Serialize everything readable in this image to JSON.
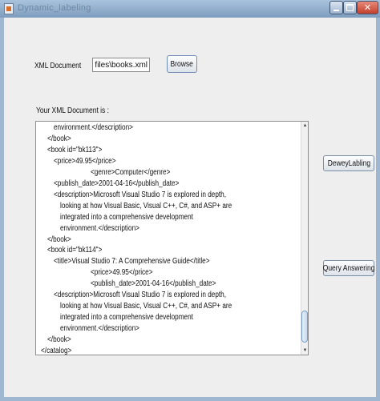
{
  "window": {
    "title": "Dynamic_labeling",
    "minimize_icon": "minimize-icon",
    "maximize_icon": "maximize-icon",
    "close_icon": "close-icon",
    "close_glyph": "✕"
  },
  "form": {
    "xml_label": "XML Document",
    "path_value": "C:\\xml files\\books.xml",
    "browse_label": "Browse",
    "doc_label": "Your XML Document is :"
  },
  "buttons": {
    "dewey_label": "DeweyLabling",
    "query_label": "Query Answering"
  },
  "document": {
    "lines": [
      {
        "indent": 3,
        "text": "environment.</description>"
      },
      {
        "indent": 2,
        "text": "</book>"
      },
      {
        "indent": 2,
        "text": "<book id=\"bk113\">"
      },
      {
        "indent": 3,
        "text": "<price>49.95</price>"
      },
      {
        "indent": 5,
        "text": "<genre>Computer</genre>"
      },
      {
        "indent": 3,
        "text": "<publish_date>2001-04-16</publish_date>"
      },
      {
        "indent": 3,
        "text": "<description>Microsoft Visual Studio 7 is explored in depth,"
      },
      {
        "indent": 4,
        "text": "looking at how Visual Basic, Visual C++, C#, and ASP+ are"
      },
      {
        "indent": 4,
        "text": "integrated into a comprehensive development"
      },
      {
        "indent": 4,
        "text": "environment.</description>"
      },
      {
        "indent": 2,
        "text": "</book>"
      },
      {
        "indent": 2,
        "text": "<book id=\"bk114\">"
      },
      {
        "indent": 3,
        "text": "<title>Visual Studio 7: A Comprehensive Guide</title>"
      },
      {
        "indent": 5,
        "text": "<price>49.95</price>"
      },
      {
        "indent": 5,
        "text": "<publish_date>2001-04-16</publish_date>"
      },
      {
        "indent": 3,
        "text": "<description>Microsoft Visual Studio 7 is explored in depth,"
      },
      {
        "indent": 4,
        "text": "looking at how Visual Basic, Visual C++, C#, and ASP+ are"
      },
      {
        "indent": 4,
        "text": "integrated into a comprehensive development"
      },
      {
        "indent": 4,
        "text": "environment.</description>"
      },
      {
        "indent": 2,
        "text": "</book>"
      },
      {
        "indent": 1,
        "text": "</catalog>"
      }
    ],
    "scroll_up_icon": "scroll-up-arrow-icon",
    "scroll_down_icon": "scroll-down-arrow-icon"
  },
  "colors": {
    "title_bar": "#7d9cbd",
    "panel_bg": "#eeeeee",
    "close_button": "#c2402a"
  }
}
